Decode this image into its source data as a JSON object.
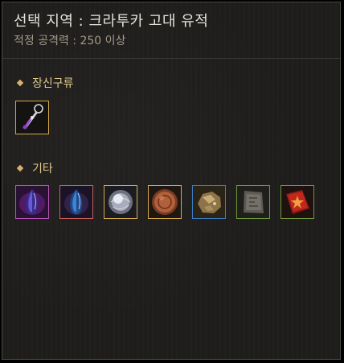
{
  "header": {
    "title": "선택 지역 : 크라투카 고대 유적",
    "subtitle": "적정 공격력 : 250 이상"
  },
  "sections": [
    {
      "label": "장신구류",
      "items": [
        {
          "icon": "earring-icon",
          "border_color": "#d5a94a"
        }
      ]
    },
    {
      "label": "기타",
      "items": [
        {
          "icon": "purple-crystal-icon",
          "border_color": "#b654b5"
        },
        {
          "icon": "blue-crystal-icon",
          "border_color": "#c9625a"
        },
        {
          "icon": "silver-orb-icon",
          "border_color": "#d5a94a"
        },
        {
          "icon": "copper-coin-icon",
          "border_color": "#d5a94a"
        },
        {
          "icon": "ore-chunk-icon",
          "border_color": "#3c7bc0"
        },
        {
          "icon": "stone-tablet-icon",
          "border_color": "#6f9a3a"
        },
        {
          "icon": "red-book-icon",
          "border_color": "#6f9a3a"
        }
      ]
    }
  ]
}
